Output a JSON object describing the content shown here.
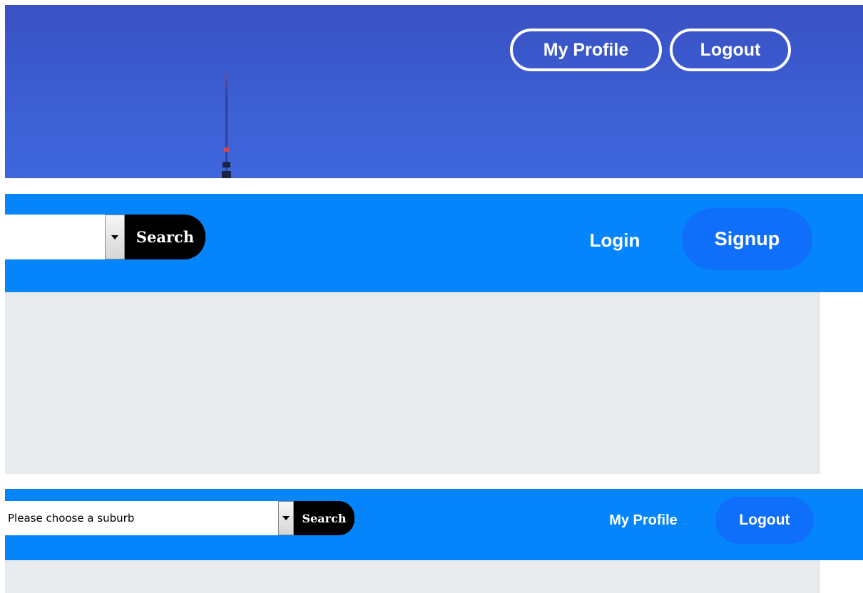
{
  "hero": {
    "profile_label": "My Profile",
    "logout_label": "Logout"
  },
  "nav_guest": {
    "suburb_select": {
      "value": ""
    },
    "search_label": "Search",
    "login_label": "Login",
    "signup_label": "Signup"
  },
  "nav_user": {
    "suburb_select": {
      "value": "Please choose a suburb"
    },
    "search_label": "Search",
    "profile_label": "My Profile",
    "logout_label": "Logout"
  },
  "colors": {
    "nav_bar": "#0585fb",
    "pill_button": "#0f6ffb",
    "search_button": "#000000",
    "content_bg": "#e7ebed",
    "hero_sky": "#3c5fd3"
  },
  "icons": {
    "dropdown": "chevron-down-icon",
    "tower": "radio-tower-icon"
  }
}
